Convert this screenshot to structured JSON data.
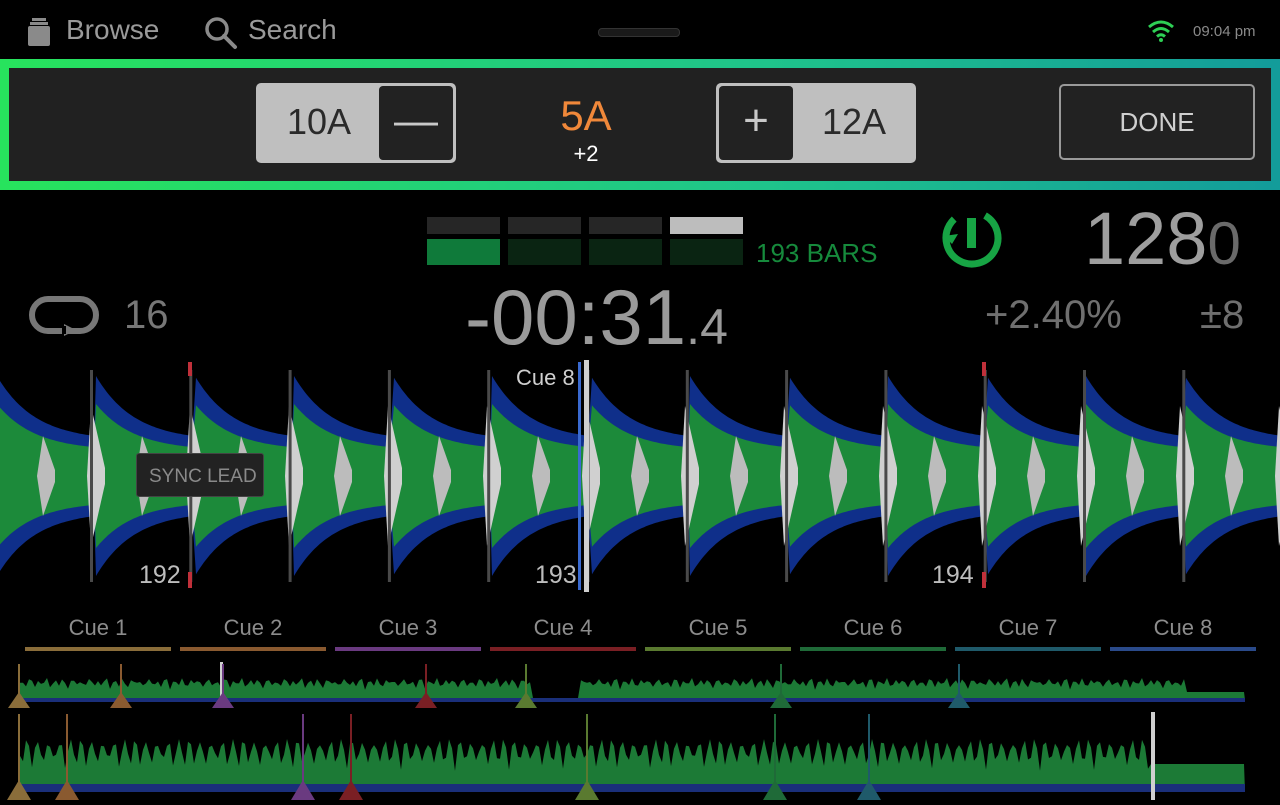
{
  "topbar": {
    "browse_label": "Browse",
    "search_label": "Search",
    "time": "09:04 pm",
    "icons": [
      "browse-icon",
      "search-icon",
      "wifi-icon"
    ]
  },
  "key_panel": {
    "lower_key": "10A",
    "current_key": "5A",
    "offset": "+2",
    "higher_key": "12A",
    "minus_label": "—",
    "plus_label": "+",
    "done_label": "DONE"
  },
  "info": {
    "bars_label": "193 BARS",
    "bpm_main": "128",
    "bpm_decimal": "0",
    "loop_size": "16",
    "time_remaining_main": "-00:31",
    "time_remaining_tenths": ".4",
    "pitch_percent": "+2.40%",
    "pitch_range": "±8",
    "bar_phase_active": 1
  },
  "waveform": {
    "cue_marker_label": "Cue 8",
    "sync_label": "SYNC LEAD",
    "bar_numbers": [
      "192",
      "193",
      "194"
    ]
  },
  "cue_pads": [
    {
      "label": "Cue 1",
      "color": "#8a6d3a"
    },
    {
      "label": "Cue 2",
      "color": "#8a5a30"
    },
    {
      "label": "Cue 3",
      "color": "#6a3a80"
    },
    {
      "label": "Cue 4",
      "color": "#7a1f24"
    },
    {
      "label": "Cue 5",
      "color": "#5a7a30"
    },
    {
      "label": "Cue 6",
      "color": "#1f6a38"
    },
    {
      "label": "Cue 7",
      "color": "#1f5a6a"
    },
    {
      "label": "Cue 8",
      "color": "#2a4a8a"
    }
  ],
  "colors": {
    "accent_green": "#1a8a3a",
    "key_orange": "#f0883a",
    "panel_border": "#27e35d",
    "wave_blue": "#0f2f8a",
    "wave_green": "#1c8a3a"
  }
}
